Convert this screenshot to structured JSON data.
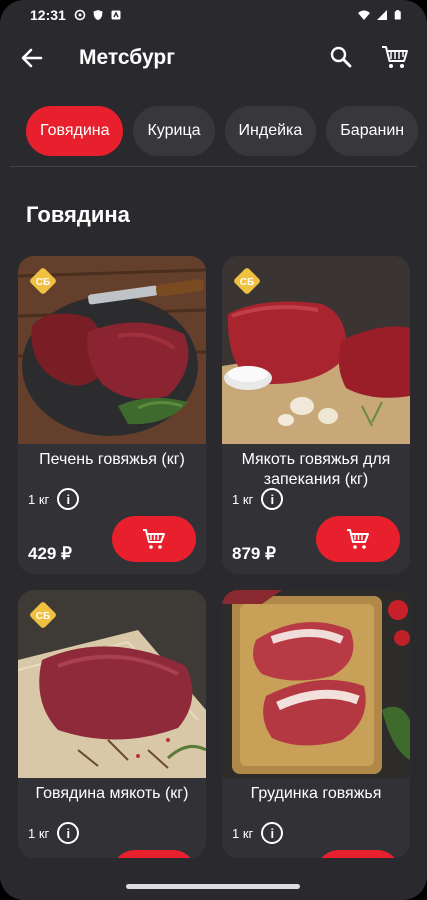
{
  "status_bar": {
    "time": "12:31"
  },
  "header": {
    "title": "Метсбург"
  },
  "categories": [
    {
      "label": "Говядина"
    },
    {
      "label": "Курица"
    },
    {
      "label": "Индейка"
    },
    {
      "label": "Баранин"
    }
  ],
  "section": {
    "title": "Говядина"
  },
  "products": [
    {
      "name": "Печень говяжья (кг)",
      "weight": "1 кг",
      "price": "429 ₽"
    },
    {
      "name": "Мякоть говяжья для запекания (кг)",
      "weight": "1 кг",
      "price": "879 ₽"
    },
    {
      "name": "Говядина мякоть (кг)",
      "weight": "1 кг",
      "price": ""
    },
    {
      "name": "Грудинка говяжья",
      "weight": "1 кг",
      "price": ""
    }
  ],
  "badge_text": "СБ",
  "colors": {
    "accent": "#e8202e",
    "background": "#2a2a2e",
    "card": "#323236"
  },
  "icons": [
    "back-arrow-icon",
    "search-icon",
    "cart-icon",
    "info-icon",
    "add-to-cart-icon",
    "discount-tag-icon"
  ]
}
